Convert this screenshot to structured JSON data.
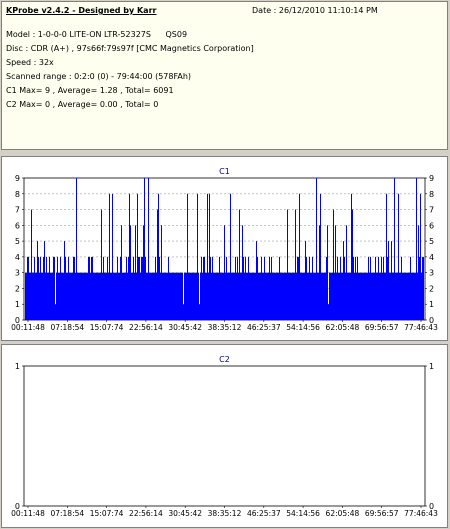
{
  "header": {
    "app_title": "KProbe v2.4.2 - Designed by Karr",
    "date": "Date : 26/12/2010 11:10:14 PM"
  },
  "info": {
    "model": "Model : 1-0-0-0 LITE-ON LTR-52327S",
    "model_code": "QS09",
    "disc": "Disc : CDR (A+) , 97s66f:79s97f [CMC Magnetics Corporation]",
    "speed": "Speed : 32x",
    "scanned_range": "Scanned range : 0:2:0 (0) - 79:44:00 (578FAh)",
    "c1_stats": "C1 Max= 9 , Average= 1.28 , Total= 6091",
    "c2_stats": "C2 Max= 0 , Average= 0.00 , Total= 0"
  },
  "colors": {
    "bar": "#0000ff",
    "plot_bg": "#ffffff",
    "grid": "#a0a0a0",
    "title": "#000080",
    "frame": "#808080"
  },
  "chart_data": [
    {
      "type": "bar",
      "title": "C1",
      "ylim": [
        0,
        9
      ],
      "y_ticks": [
        "0",
        "1",
        "2",
        "3",
        "4",
        "5",
        "6",
        "7",
        "8",
        "9"
      ],
      "x_tick_labels": [
        "00:11:48",
        "07:18:54",
        "15:07:74",
        "22:56:14",
        "30:45:42",
        "38:35:12",
        "46:25:37",
        "54:14:56",
        "62:05:48",
        "69:56:57",
        "77:46:43"
      ],
      "grid": true,
      "typical_level": 3,
      "secondary_level": 4,
      "peak_values_sample": [
        9,
        8,
        7,
        6,
        5,
        6,
        7,
        8,
        9,
        5,
        6,
        7,
        6,
        8,
        7,
        9,
        6,
        7,
        5,
        8
      ],
      "max": 9,
      "average": 1.28
    },
    {
      "type": "bar",
      "title": "C2",
      "ylim": [
        0,
        1
      ],
      "y_ticks": [
        "0",
        "1"
      ],
      "x_tick_labels": [
        "00:11:48",
        "07:18:54",
        "15:07:74",
        "22:56:14",
        "30:45:42",
        "38:35:12",
        "46:25:37",
        "54:14:56",
        "62:05:48",
        "69:56:57",
        "77:46:43"
      ],
      "grid": true,
      "values": [],
      "max": 0,
      "average": 0
    }
  ]
}
